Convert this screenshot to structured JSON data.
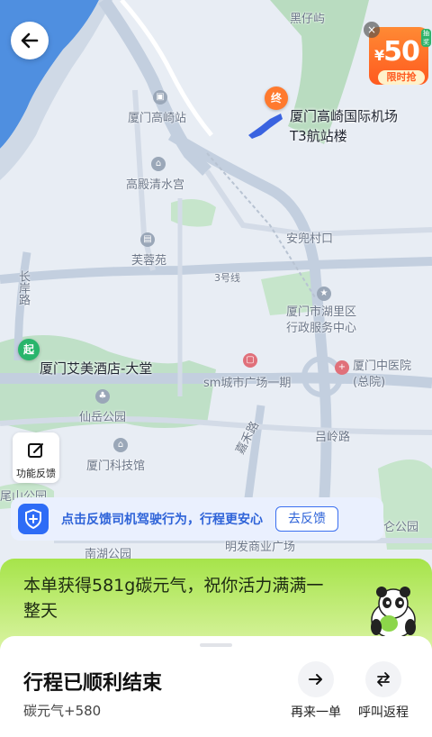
{
  "map": {
    "labels": [
      {
        "id": "heizaiyu",
        "text": "黑仔屿"
      },
      {
        "id": "gaoqi-station",
        "text": "厦门高崎站"
      },
      {
        "id": "gaodian",
        "text": "高殿清水宫"
      },
      {
        "id": "anbao",
        "text": "安兜村口"
      },
      {
        "id": "furongyuan",
        "text": "芙蓉苑"
      },
      {
        "id": "line3",
        "text": "3号线"
      },
      {
        "id": "huli-gov",
        "text": "厦门市湖里区\n行政服务中心"
      },
      {
        "id": "changan-road",
        "text": "长岸路"
      },
      {
        "id": "zhongyiyuan",
        "text": "厦门中医院\n(总院)"
      },
      {
        "id": "sm",
        "text": "sm城市广场一期"
      },
      {
        "id": "xianyue",
        "text": "仙岳公园"
      },
      {
        "id": "lvling",
        "text": "吕岭路"
      },
      {
        "id": "kejiguan",
        "text": "厦门科技馆"
      },
      {
        "id": "jiahe",
        "text": "嘉禾路"
      },
      {
        "id": "weishan",
        "text": "尾山公园"
      },
      {
        "id": "nanhu",
        "text": "南湖公园"
      },
      {
        "id": "bottom-road",
        "text": "明发商业广场"
      },
      {
        "id": "right-park",
        "text": "仑公园"
      }
    ],
    "destination": {
      "marker": "终",
      "name_line1": "厦门高崎国际机场",
      "name_line2": "T3航站楼"
    },
    "origin": {
      "marker": "起",
      "name": "厦门艾美酒店-大堂"
    }
  },
  "promo": {
    "close": "×",
    "currency": "¥",
    "amount": "50",
    "tag": "抽奖",
    "subtitle": "限时抢"
  },
  "feedback_tool": {
    "label": "功能反馈"
  },
  "safety_banner": {
    "text": "点击反馈司机驾驶行为，行程更安心",
    "button": "去反馈"
  },
  "carbon_card": {
    "message": "本单获得581g碳元气，祝你活力满满一整天"
  },
  "sheet": {
    "title": "行程已顺利结束",
    "carbon": "碳元气+580",
    "actions": [
      {
        "id": "again",
        "label": "再来一单"
      },
      {
        "id": "return",
        "label": "呼叫返程"
      }
    ]
  },
  "colors": {
    "accent": "#2e6cf6",
    "start": "#28b56b",
    "end": "#ff7a2e",
    "promo": "#ff5a1f",
    "carbon": "#a6e44a"
  }
}
